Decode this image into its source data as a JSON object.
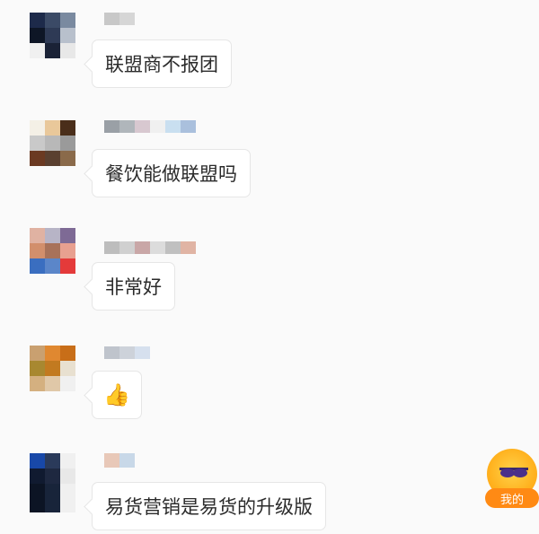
{
  "messages": [
    {
      "text": "联盟商不报团",
      "avatar_colors": [
        "#1d2a4a",
        "#3b4a66",
        "#7a8aa0",
        "#0e1626",
        "#2e3a55",
        "#b8c0cc",
        "#f0f0f0",
        "#1a2236",
        "#e8e8e8"
      ],
      "name_colors": [
        "#c8c8c8",
        "#d6d6d6"
      ]
    },
    {
      "text": "餐饮能做联盟吗",
      "avatar_colors": [
        "#f4f0e6",
        "#e9c89a",
        "#4a2e1a",
        "#c9c9c9",
        "#b8b8b8",
        "#9a9a9a",
        "#6b3a22",
        "#5a4030",
        "#8a6a4a"
      ],
      "name_colors": [
        "#9aa0a6",
        "#b0b6bb",
        "#d8c8d0",
        "#f0f0f0",
        "#c9dff0",
        "#aac0dd"
      ]
    },
    {
      "text": "非常好",
      "avatar_colors": [
        "#e0b2a2",
        "#b7b4c6",
        "#7e6a95",
        "#d28f6c",
        "#a8725a",
        "#e8a090",
        "#3a6ec0",
        "#5b86c9",
        "#e43a3a"
      ],
      "name_colors": [
        "#bdbdbd",
        "#d0d0d0",
        "#c9a7a7",
        "#dcdcdc",
        "#c0c0c0",
        "#e0b4a4"
      ]
    },
    {
      "text": "",
      "emoji": "👍",
      "avatar_colors": [
        "#c9a070",
        "#e08830",
        "#c86e18",
        "#a88830",
        "#c27a20",
        "#e8e0d0",
        "#d4b080",
        "#e0c8a8",
        "#f0f0f0"
      ],
      "name_colors": [
        "#bfc4cc",
        "#cdd2da",
        "#d6e0ee"
      ]
    },
    {
      "text": "易货营销是易货的升级版",
      "avatar_colors": [
        "#1848a8",
        "#2a3a5a",
        "#f0f0f0",
        "#101a30",
        "#1e2840",
        "#e8e8e8",
        "#0c1424",
        "#18243a",
        "#f0f0f0"
      ],
      "name_colors": [
        "#e8c8b8",
        "#c8d8e8"
      ]
    }
  ],
  "float_button": {
    "label": "我的",
    "icon": "sunglasses-face-icon"
  }
}
